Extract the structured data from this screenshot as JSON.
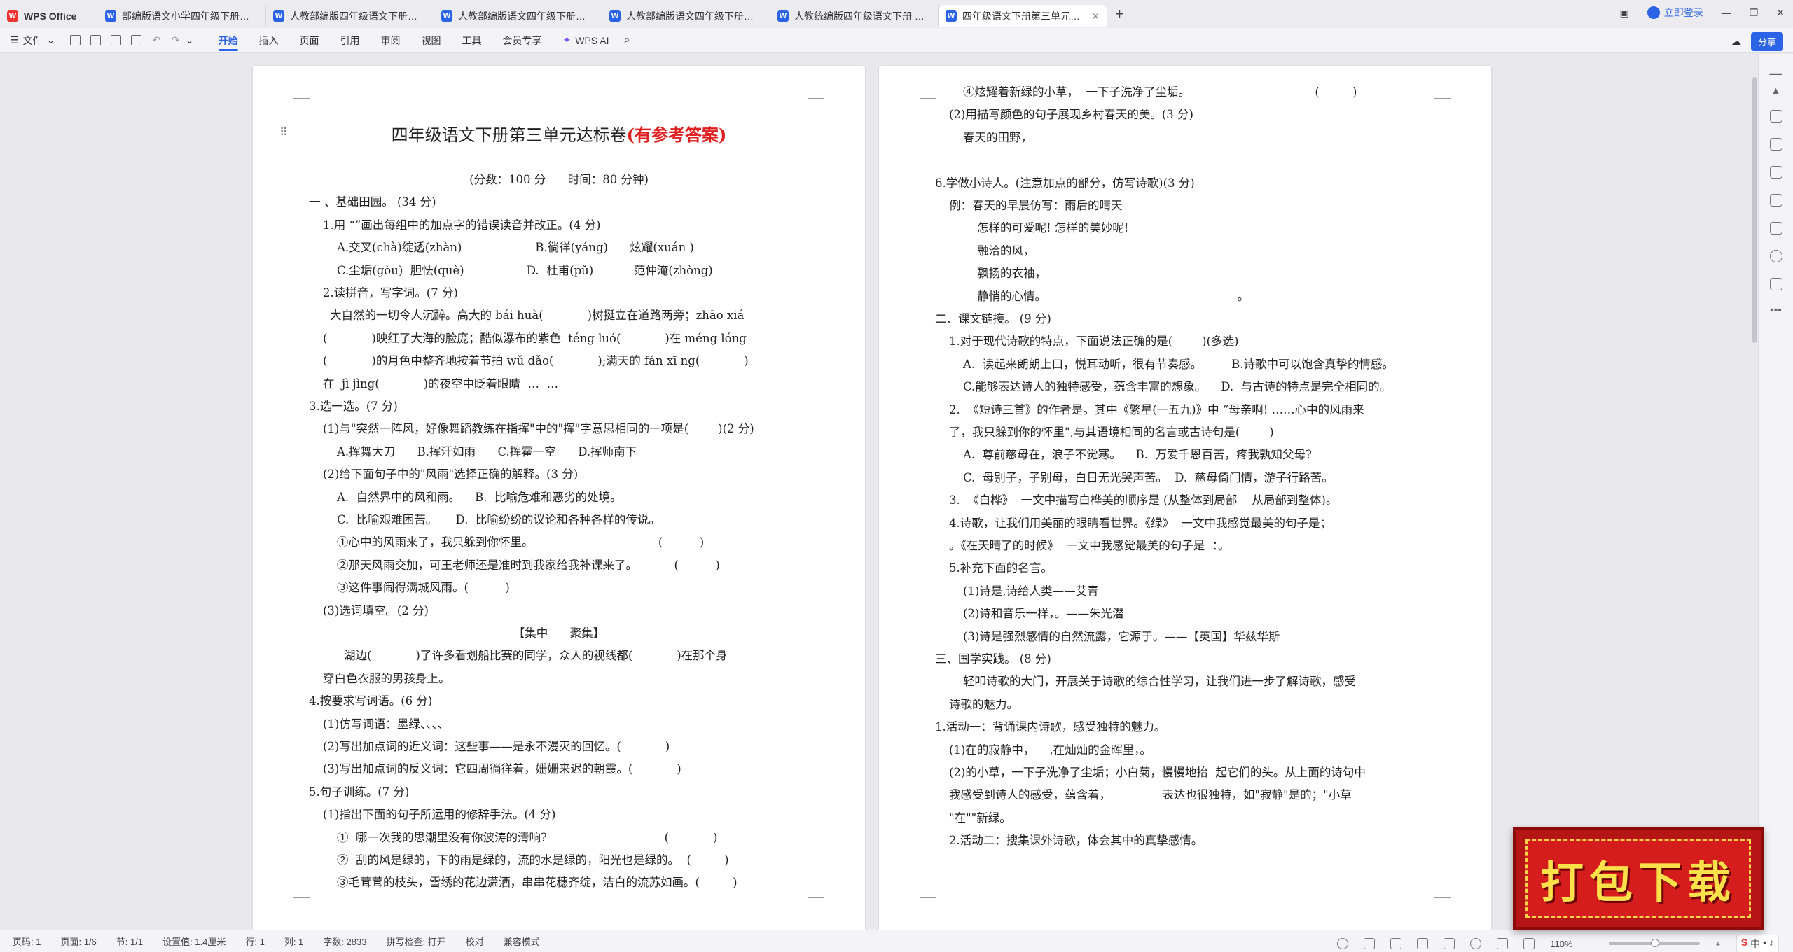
{
  "tabs": [
    {
      "label": "WPS Office",
      "icon": "wps-logo-icon"
    },
    {
      "label": "部编版语文小学四年级下册第三单元...",
      "icon": "word-doc-icon"
    },
    {
      "label": "人教部编版四年级语文下册重点学校...",
      "icon": "word-doc-icon"
    },
    {
      "label": "人教部编版语文四年级下册第三单元...",
      "icon": "word-doc-icon"
    },
    {
      "label": "人教部编版语文四年级下册第三单元...",
      "icon": "word-doc-icon"
    },
    {
      "label": "人教统编版四年级语文下册 第3单元...",
      "icon": "word-doc-icon"
    },
    {
      "label": "四年级语文下册第三单元达标...",
      "icon": "word-doc-icon",
      "active": true
    }
  ],
  "tabbar": {
    "new_tab": "+",
    "login": "立即登录"
  },
  "ribbon": {
    "file_menu": "文件",
    "tabs": [
      "开始",
      "插入",
      "页面",
      "引用",
      "审阅",
      "视图",
      "工具",
      "会员专享"
    ],
    "active_tab": "开始",
    "wps_ai": "WPS AI",
    "share": "分享"
  },
  "document": {
    "title": "四年级语文下册第三单元达标卷",
    "title_suffix": "(有参考答案)",
    "page1_lines": [
      "(分数：100 分      时间：80 分钟)",
      "一 、基础田园。 (34 分)",
      "1.用 “”画出每组中的加点字的错误读音并改正。(4 分)",
      "A.交叉(chà)绽透(zhàn)                    B.徜徉(yáng)      炫耀(xuán )",
      "C.尘垢(gòu)  胆怯(què)                 D.  杜甫(pǔ)           范仲淹(zhòng)",
      "2.读拼音，写字词。(7 分)",
      "大自然的一切令人沉醉。高大的 bái huà(            )树挺立在道路两旁；zhāo xiá",
      "(            )映红了大海的脸庞；酷似瀑布的紫色  téng luó(            )在 méng lóng",
      "(            )的月色中整齐地按着节拍 wǔ dǎo(            );满天的 fán xī ng(            )",
      "在  jì jìng(            )的夜空中眨着眼睛  …  …",
      "3.选一选。(7 分)",
      "(1)与\"突然一阵风，好像舞蹈教练在指挥\"中的\"挥\"字意思相同的一项是(        )(2 分)",
      "A.挥舞大刀      B.挥汗如雨      C.挥霍一空      D.挥师南下",
      "(2)给下面句子中的\"风雨\"选择正确的解释。(3 分)",
      "A.  自然界中的风和雨。    B.  比喻危难和恶劣的处境。",
      "C.  比喻艰难困苦。     D.  比喻纷纷的议论和各种各样的传说。",
      "①心中的风雨来了，我只躲到你怀里。                                  (          )",
      "②那天风雨交加，可王老师还是准时到我家给我补课来了。          (          )",
      "③这件事闹得满城风雨。(          )",
      "(3)选词填空。(2 分)",
      "【集中      聚集】",
      "湖边(            )了许多看划船比赛的同学，众人的视线都(            )在那个身",
      "穿白色衣服的男孩身上。",
      "4.按要求写词语。(6 分)",
      "(1)仿写词语：墨绿、、、、",
      "(2)写出加点词的近义词：这些事——是永不漫灭的回忆。(            )",
      "(3)写出加点词的反义词：它四周徜徉着，姗姗来迟的朝霞。(            )",
      "5.句子训练。(7 分)",
      "(1)指出下面的句子所运用的修辞手法。(4 分)",
      "①  哪一次我的思潮里没有你波涛的清响?                                (            )",
      "②  刮的风是绿的，下的雨是绿的，流的水是绿的，阳光也是绿的。  (         )",
      "③毛茸茸的枝头，雪绣的花边潇洒，串串花穗齐绽，洁白的流苏如画。(         )"
    ],
    "page2_lines": [
      "④炫耀着新绿的小草，  一下子洗净了尘垢。                                  (         )",
      "(2)用描写颜色的句子展现乡村春天的美。(3 分)",
      "春天的田野，",
      "6.学做小诗人。(注意加点的部分，仿写诗歌)(3 分)",
      "例：春天的早晨仿写：雨后的晴天",
      "怎样的可爱呢! 怎样的美妙呢!",
      "融洽的风，",
      "飘扬的衣袖，",
      "静悄的心情。                                                    。",
      "二、课文链接。 (9 分)",
      "1.对于现代诗歌的特点，下面说法正确的是(        )(多选)",
      "A.  读起来朗朗上口，悦耳动听，很有节奏感。        B.诗歌中可以饱含真挚的情感。",
      "C.能够表达诗人的独特感受，蕴含丰富的想象。    D.  与古诗的特点是完全相同的。",
      "2.  《短诗三首》的作者是。其中《繁星(一五九)》中 “母亲啊! ……心中的风雨来",
      "了，我只躲到你的怀里\",与其语境相同的名言或古诗句是(        )",
      "A.  尊前慈母在，浪子不觉寒。    B.  万爱千恩百苦，疼我孰知父母?",
      "C.  母别子，子别母，白日无光哭声苦。  D.  慈母倚门情，游子行路苦。",
      "3.  《白桦》  一文中描写白桦美的顺序是 (从整体到局部    从局部到整体)。",
      "4.诗歌，让我们用美丽的眼睛看世界。《绿》  一文中我感觉最美的句子是；",
      "。《在天晴了的时候》  一文中我感觉最美的句子是  ：。",
      "5.补充下面的名言。",
      "(1)诗是,诗给人类——艾青",
      "(2)诗和音乐一样，。——朱光潜",
      "(3)诗是强烈感情的自然流露，它源于。——【英国】华兹华斯",
      "三、国学实践。 (8 分)",
      "轻叩诗歌的大门，开展关于诗歌的综合性学习，让我们进一步了解诗歌，感受",
      "诗歌的魅力。",
      "1.活动一：背诵课内诗歌，感受独特的魅力。",
      "(1)在的寂静中，    ,在灿灿的金晖里，。",
      "(2)的小草，一下子洗净了尘垢；小白菊，慢慢地抬  起它们的头。从上面的诗句中",
      "我感受到诗人的感受，蕴含着，              表达也很独特，如\"寂静\"是的；\"小草",
      "\"在\"\"新绿。",
      "2.活动二：搜集课外诗歌，体会其中的真挚感情。"
    ]
  },
  "status": {
    "page_num": "页码: 1",
    "page_of": "页面: 1/6",
    "section": "节: 1/1",
    "setting": "设置值: 1.4厘米",
    "row": "行: 1",
    "col": "列: 1",
    "word_count": "字数: 2833",
    "spell_check": "拼写检查: 打开",
    "proofread": "校对",
    "compat": "兼容模式",
    "zoom": "110%"
  },
  "badge": {
    "text": "打包下载"
  },
  "colors": {
    "accent": "#2b63e6",
    "title_red": "#e02020",
    "badge_red": "#d61d1d",
    "badge_text": "#fde14b"
  }
}
